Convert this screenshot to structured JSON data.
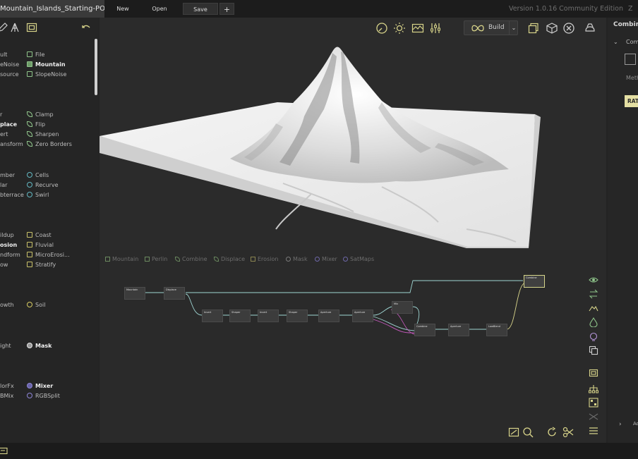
{
  "titlebar": {
    "document": "Mountain_Islands_Starting-POint.tor",
    "new_label": "New",
    "open_label": "Open",
    "save_label": "Save",
    "add_label": "+",
    "version": "Version 1.0.16 Community Edition",
    "version_extra": "Z"
  },
  "library": {
    "rows": [
      {
        "left": "ult",
        "left_bold": false,
        "right": "File",
        "right_bold": false,
        "icon": "sq-green"
      },
      {
        "left": "eNoise",
        "left_bold": false,
        "right": "Mountain",
        "right_bold": true,
        "icon": "sq-green fill"
      },
      {
        "left": "source",
        "left_bold": false,
        "right": "SlopeNoise",
        "right_bold": false,
        "icon": "sq-green"
      },
      {
        "left": "r",
        "left_bold": false,
        "right": "Clamp",
        "right_bold": false,
        "icon": "leaf"
      },
      {
        "left": "place",
        "left_bold": true,
        "right": "Flip",
        "right_bold": false,
        "icon": "leaf"
      },
      {
        "left": "ert",
        "left_bold": false,
        "right": "Sharpen",
        "right_bold": false,
        "icon": "leaf"
      },
      {
        "left": "ansform",
        "left_bold": false,
        "right": "Zero Borders",
        "right_bold": false,
        "icon": "leaf"
      },
      {
        "left": "mber",
        "left_bold": false,
        "right": "Cells",
        "right_bold": false,
        "icon": "circ-teal"
      },
      {
        "left": "lar",
        "left_bold": false,
        "right": "Recurve",
        "right_bold": false,
        "icon": "circ-teal"
      },
      {
        "left": "bterrace",
        "left_bold": false,
        "right": "Swirl",
        "right_bold": false,
        "icon": "circ-teal"
      },
      {
        "left": "ildup",
        "left_bold": false,
        "right": "Coast",
        "right_bold": false,
        "icon": "sq-yellow"
      },
      {
        "left": "osion",
        "left_bold": true,
        "right": "Fluvial",
        "right_bold": false,
        "icon": "sq-yellow"
      },
      {
        "left": "ndform",
        "left_bold": false,
        "right": "MicroErosi...",
        "right_bold": false,
        "icon": "sq-yellow"
      },
      {
        "left": "ow",
        "left_bold": false,
        "right": "Stratify",
        "right_bold": false,
        "icon": "sq-yellow"
      },
      {
        "left": "owth",
        "left_bold": false,
        "right": "Soil",
        "right_bold": false,
        "icon": "circ-yellow"
      },
      {
        "left": "ight",
        "left_bold": false,
        "right": "Mask",
        "right_bold": true,
        "icon": "circ-white"
      },
      {
        "left": "lorFx",
        "left_bold": false,
        "right": "Mixer",
        "right_bold": true,
        "icon": "circ-purple fill"
      },
      {
        "left": "BMix",
        "left_bold": false,
        "right": "RGBSplit",
        "right_bold": false,
        "icon": "circ-purple"
      }
    ]
  },
  "toolbar": {
    "build_label": "Build",
    "build_dropdown": "⌄"
  },
  "graph": {
    "tabs": [
      "Mountain",
      "Perlin",
      "Combine",
      "Displace",
      "Erosion",
      "Mask",
      "Mixer",
      "SatMaps"
    ],
    "nodes": [
      {
        "title": "Mountain"
      },
      {
        "title": "Displace"
      },
      {
        "title": "Invert"
      },
      {
        "title": "Shaper"
      },
      {
        "title": "Invert"
      },
      {
        "title": "Shaper"
      },
      {
        "title": "Aperture"
      },
      {
        "title": "Aperture"
      },
      {
        "title": "Mix"
      },
      {
        "title": "Combine"
      },
      {
        "title": "Aperture"
      },
      {
        "title": "LowBlend"
      },
      {
        "title": "Combine"
      }
    ]
  },
  "properties": {
    "title": "Combine",
    "section": "Com",
    "method_label": "Meth",
    "ratio_label": "RAT",
    "bottom_label": "Ad"
  },
  "colors": {
    "accent_yellow": "#e4dfa3",
    "wire_cyan": "#9fd6d3",
    "wire_yellow": "#d8d48a",
    "wire_magenta": "#c85ac0"
  }
}
